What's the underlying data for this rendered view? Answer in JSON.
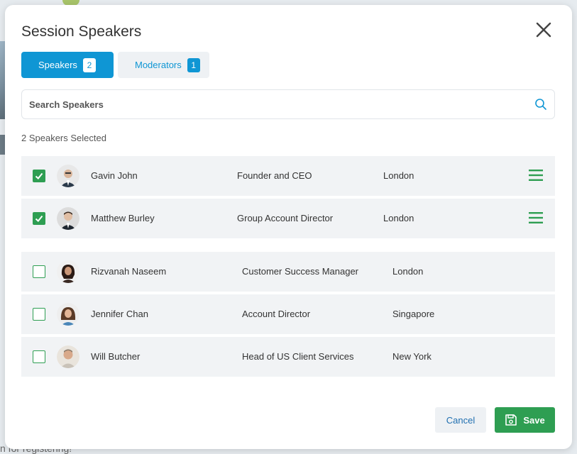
{
  "modal": {
    "title": "Session Speakers",
    "close_icon": "close-icon"
  },
  "tabs": [
    {
      "label": "Speakers",
      "count": "2",
      "active": true
    },
    {
      "label": "Moderators",
      "count": "1",
      "active": false
    }
  ],
  "search": {
    "placeholder": "Search Speakers",
    "value": "",
    "icon": "search-icon"
  },
  "selected_count": "2 Speakers Selected",
  "selected_speakers": [
    {
      "name": "Gavin John",
      "role": "Founder and CEO",
      "city": "London",
      "checked": true
    },
    {
      "name": "Matthew Burley",
      "role": "Group Account Director",
      "city": "London",
      "checked": true
    }
  ],
  "available_speakers": [
    {
      "name": "Rizvanah Naseem",
      "role": "Customer Success Manager",
      "city": "London",
      "checked": false
    },
    {
      "name": "Jennifer Chan",
      "role": "Account Director",
      "city": "Singapore",
      "checked": false
    },
    {
      "name": "Will Butcher",
      "role": "Head of US Client Services",
      "city": "New York",
      "checked": false
    }
  ],
  "footer": {
    "cancel_label": "Cancel",
    "save_label": "Save",
    "save_icon": "floppy-disk-icon"
  },
  "colors": {
    "primary_blue": "#0f96d4",
    "success_green": "#2e9e52",
    "row_bg": "#f1f3f5"
  },
  "background": {
    "text": "n for registering!"
  }
}
